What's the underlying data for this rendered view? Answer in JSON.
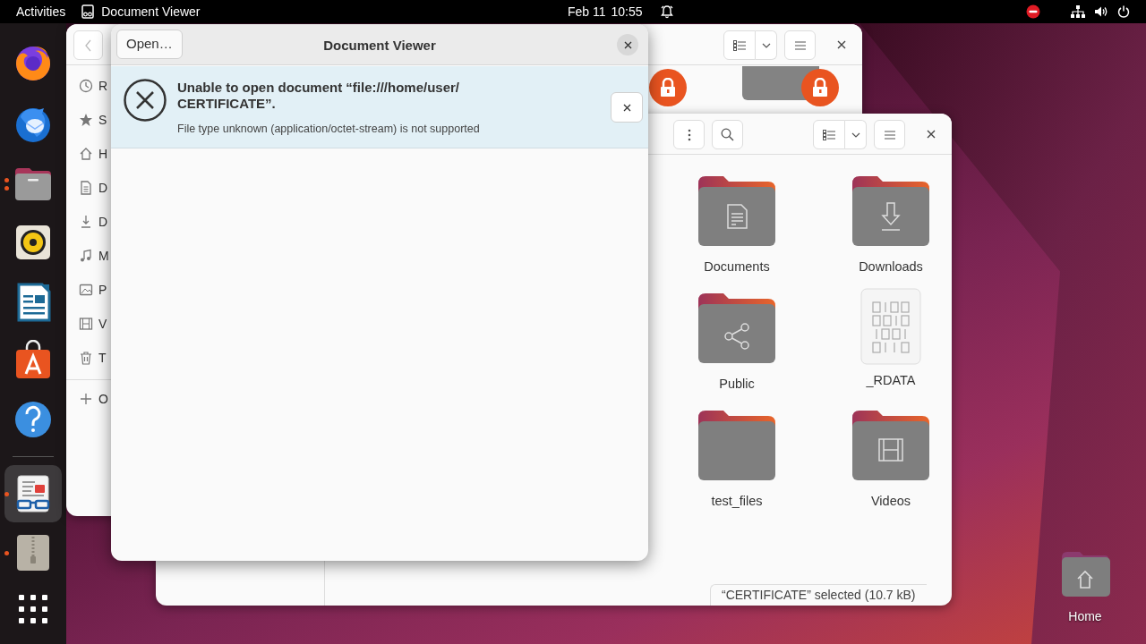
{
  "top_bar": {
    "activities": "Activities",
    "app_name": "Document Viewer",
    "date": "Feb 11",
    "time": "10:55",
    "do_not_disturb": true
  },
  "dock": [
    {
      "kind": "browser",
      "running": false,
      "multiple_windows": false,
      "selected": false
    },
    {
      "kind": "mail",
      "running": false,
      "multiple_windows": false,
      "selected": false
    },
    {
      "kind": "files",
      "running": true,
      "multiple_windows": true,
      "selected": false
    },
    {
      "kind": "music",
      "running": false,
      "multiple_windows": false,
      "selected": false
    },
    {
      "kind": "writer",
      "running": false,
      "multiple_windows": false,
      "selected": false
    },
    {
      "kind": "store",
      "running": false,
      "multiple_windows": false,
      "selected": false
    },
    {
      "kind": "help",
      "running": false,
      "multiple_windows": false,
      "selected": false
    },
    {
      "kind": "viewer",
      "running": true,
      "multiple_windows": false,
      "selected": true
    },
    {
      "kind": "archive",
      "running": true,
      "multiple_windows": false,
      "selected": false
    },
    {
      "kind": "grid",
      "running": false,
      "multiple_windows": false,
      "selected": false
    }
  ],
  "back_window": {
    "sidebar": [
      {
        "kind": "recent",
        "label": "R"
      },
      {
        "kind": "starred",
        "label": "S"
      },
      {
        "kind": "home",
        "label": "H"
      },
      {
        "kind": "documents",
        "label": "D"
      },
      {
        "kind": "downloads",
        "label": "D"
      },
      {
        "kind": "music",
        "label": "M"
      },
      {
        "kind": "pictures",
        "label": "P"
      },
      {
        "kind": "videos",
        "label": "V"
      },
      {
        "kind": "trash",
        "label": "T"
      },
      {
        "kind": "other",
        "label": "O"
      }
    ]
  },
  "file_window": {
    "items": [
      {
        "kind": "documents",
        "label": "Documents"
      },
      {
        "kind": "downloads",
        "label": "Downloads"
      },
      {
        "kind": "public",
        "label": "Public"
      },
      {
        "kind": "binary",
        "label": "_RDATA"
      },
      {
        "kind": "plain",
        "label": "test_files"
      },
      {
        "kind": "videos",
        "label": "Videos"
      }
    ],
    "status": "“CERTIFICATE” selected (10.7 kB)"
  },
  "document_viewer": {
    "open_button": "Open…",
    "title": "Document Viewer",
    "error_title": "Unable to open document “file:///home/user/\nCERTIFICATE”.",
    "error_detail": "File type unknown (application/octet-stream) is not supported"
  },
  "desktop_icons": [
    {
      "label": "Home"
    }
  ]
}
